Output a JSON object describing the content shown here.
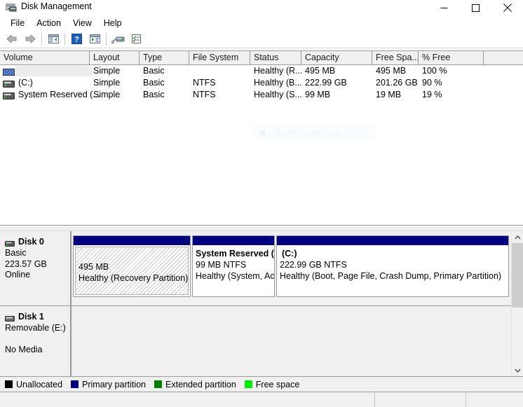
{
  "window": {
    "title": "Disk Management",
    "icon": "disk-management-icon",
    "controls": [
      {
        "name": "minimize-button",
        "glyph": "minimize"
      },
      {
        "name": "maximize-button",
        "glyph": "maximize"
      },
      {
        "name": "close-button",
        "glyph": "close"
      }
    ]
  },
  "menubar": {
    "items": [
      {
        "label": "File",
        "name": "menu-file"
      },
      {
        "label": "Action",
        "name": "menu-action"
      },
      {
        "label": "View",
        "name": "menu-view"
      },
      {
        "label": "Help",
        "name": "menu-help"
      }
    ]
  },
  "toolbar": {
    "buttons": [
      {
        "name": "back-button",
        "icon": "back-arrow-icon"
      },
      {
        "name": "forward-button",
        "icon": "forward-arrow-icon"
      },
      {
        "name": "show-hide-console-tree-button",
        "icon": "console-tree-icon"
      },
      {
        "name": "help-button",
        "icon": "question-mark-icon"
      },
      {
        "name": "show-hide-action-pane-button",
        "icon": "action-pane-icon"
      },
      {
        "name": "rescan-disks-button",
        "icon": "rescan-disks-icon"
      },
      {
        "name": "properties-button",
        "icon": "properties-checklist-icon"
      }
    ]
  },
  "volume_list": {
    "columns": [
      {
        "label": "Volume",
        "name": "column-volume"
      },
      {
        "label": "Layout",
        "name": "column-layout"
      },
      {
        "label": "Type",
        "name": "column-type"
      },
      {
        "label": "File System",
        "name": "column-file-system"
      },
      {
        "label": "Status",
        "name": "column-status"
      },
      {
        "label": "Capacity",
        "name": "column-capacity"
      },
      {
        "label": "Free Spa...",
        "name": "column-free-space"
      },
      {
        "label": "% Free",
        "name": "column-percent-free"
      },
      {
        "label": "",
        "name": "column-blank"
      }
    ],
    "rows": [
      {
        "volume": "",
        "layout": "Simple",
        "type": "Basic",
        "file_system": "",
        "status": "Healthy (R...",
        "capacity": "495 MB",
        "free_space": "495 MB",
        "percent_free": "100 %",
        "icon": "recovery-partition-icon",
        "selected": true
      },
      {
        "volume": "(C:)",
        "layout": "Simple",
        "type": "Basic",
        "file_system": "NTFS",
        "status": "Healthy (B...",
        "capacity": "222.99 GB",
        "free_space": "201.26 GB",
        "percent_free": "90 %",
        "icon": "volume-icon",
        "selected": false
      },
      {
        "volume": "System Reserved (...",
        "layout": "Simple",
        "type": "Basic",
        "file_system": "NTFS",
        "status": "Healthy (S...",
        "capacity": "99 MB",
        "free_space": "19 MB",
        "percent_free": "19 %",
        "icon": "volume-icon",
        "selected": false
      }
    ]
  },
  "disks": [
    {
      "name": "Disk 0",
      "type": "Basic",
      "size": "223.57 GB",
      "state": "Online",
      "icon": "disk-icon",
      "partitions": [
        {
          "name": "partition-recovery",
          "title": "",
          "size_line": "495 MB",
          "status_line": "Healthy (Recovery Partition)",
          "selected": true
        },
        {
          "name": "partition-system-reserved",
          "title": "System Reserved  (",
          "size_line": "99 MB NTFS",
          "status_line": "Healthy (System, Act",
          "selected": false
        },
        {
          "name": "partition-c",
          "title": "(C:)",
          "size_line": "222.99 GB NTFS",
          "status_line": "Healthy (Boot, Page File, Crash Dump, Primary Partition)",
          "selected": false
        }
      ]
    },
    {
      "name": "Disk 1",
      "type": "Removable (E:)",
      "size": "",
      "state": "No Media",
      "icon": "disk-icon",
      "partitions": []
    }
  ],
  "legend": {
    "items": [
      {
        "label": "Unallocated",
        "color": "#000000",
        "name": "legend-unallocated"
      },
      {
        "label": "Primary partition",
        "color": "#000080",
        "name": "legend-primary-partition"
      },
      {
        "label": "Extended partition",
        "color": "#008000",
        "name": "legend-extended-partition"
      },
      {
        "label": "Free space",
        "color": "#00ee00",
        "name": "legend-free-space"
      }
    ]
  },
  "overlay": {
    "snip_label": "Rectangular Snip"
  },
  "colors": {
    "partition_bar": "#000080",
    "chrome": "#f0f0f0",
    "border": "#9a9a9a"
  }
}
